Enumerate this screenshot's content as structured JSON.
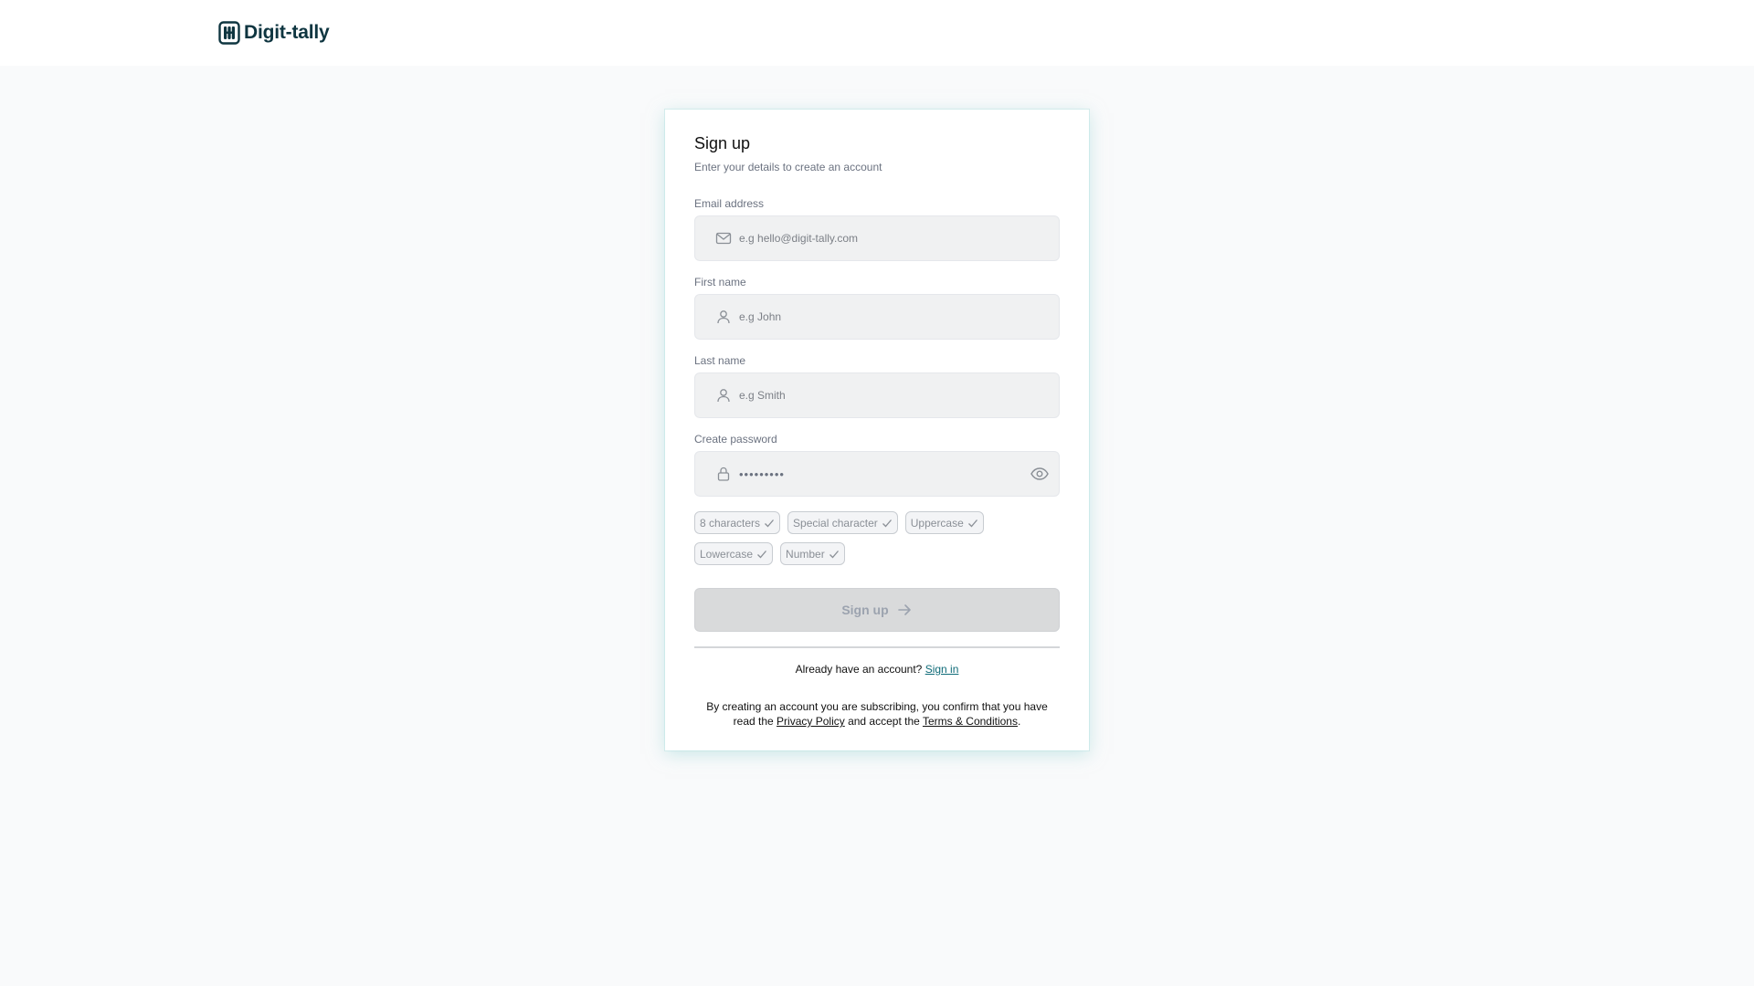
{
  "brand": {
    "name": "Digit-tally",
    "color": "#0e3540"
  },
  "signup": {
    "title": "Sign up",
    "subtitle": "Enter your details to create an account",
    "fields": {
      "email": {
        "label": "Email address",
        "placeholder": "e.g hello@digit-tally.com",
        "icon": "mail-icon"
      },
      "first_name": {
        "label": "First name",
        "placeholder": "e.g John",
        "icon": "user-icon"
      },
      "last_name": {
        "label": "Last name",
        "placeholder": "e.g Smith",
        "icon": "user-icon"
      },
      "password": {
        "label": "Create password",
        "value": "•••••••••",
        "icon": "lock-icon",
        "toggle_icon": "eye-icon"
      }
    },
    "requirements": [
      {
        "label": "8 characters",
        "icon": "check-icon"
      },
      {
        "label": "Special character",
        "icon": "check-icon"
      },
      {
        "label": "Uppercase",
        "icon": "check-icon"
      },
      {
        "label": "Lowercase",
        "icon": "check-icon"
      },
      {
        "label": "Number",
        "icon": "check-icon"
      }
    ],
    "submit_label": "Sign up",
    "submit_icon": "arrow-right-icon",
    "already_text": "Already have an account?",
    "sign_in_label": "Sign in",
    "link_color": "#0f6b78",
    "legal": {
      "prefix": "By creating an account you are subscribing, you confirm that you have read the",
      "privacy_label": "Privacy Policy",
      "middle": "and accept the",
      "terms_label": "Terms & Conditions",
      "suffix": "."
    }
  }
}
